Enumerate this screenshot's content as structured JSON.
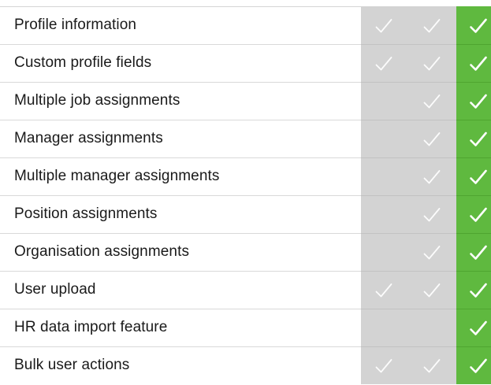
{
  "colors": {
    "basic_column": "#d3d3d3",
    "premium_column": "#5fb93f",
    "check_mark": "#ffffff"
  },
  "icons": {
    "check": "check-icon"
  },
  "features": [
    {
      "label": "Profile information",
      "tier1": true,
      "tier2": true,
      "tier3": true
    },
    {
      "label": "Custom profile fields",
      "tier1": true,
      "tier2": true,
      "tier3": true
    },
    {
      "label": "Multiple job assignments",
      "tier1": false,
      "tier2": true,
      "tier3": true
    },
    {
      "label": "Manager assignments",
      "tier1": false,
      "tier2": true,
      "tier3": true
    },
    {
      "label": "Multiple manager assignments",
      "tier1": false,
      "tier2": true,
      "tier3": true
    },
    {
      "label": "Position assignments",
      "tier1": false,
      "tier2": true,
      "tier3": true
    },
    {
      "label": "Organisation assignments",
      "tier1": false,
      "tier2": true,
      "tier3": true
    },
    {
      "label": "User upload",
      "tier1": true,
      "tier2": true,
      "tier3": true
    },
    {
      "label": "HR data import feature",
      "tier1": false,
      "tier2": false,
      "tier3": true
    },
    {
      "label": "Bulk user actions",
      "tier1": true,
      "tier2": true,
      "tier3": true
    }
  ]
}
